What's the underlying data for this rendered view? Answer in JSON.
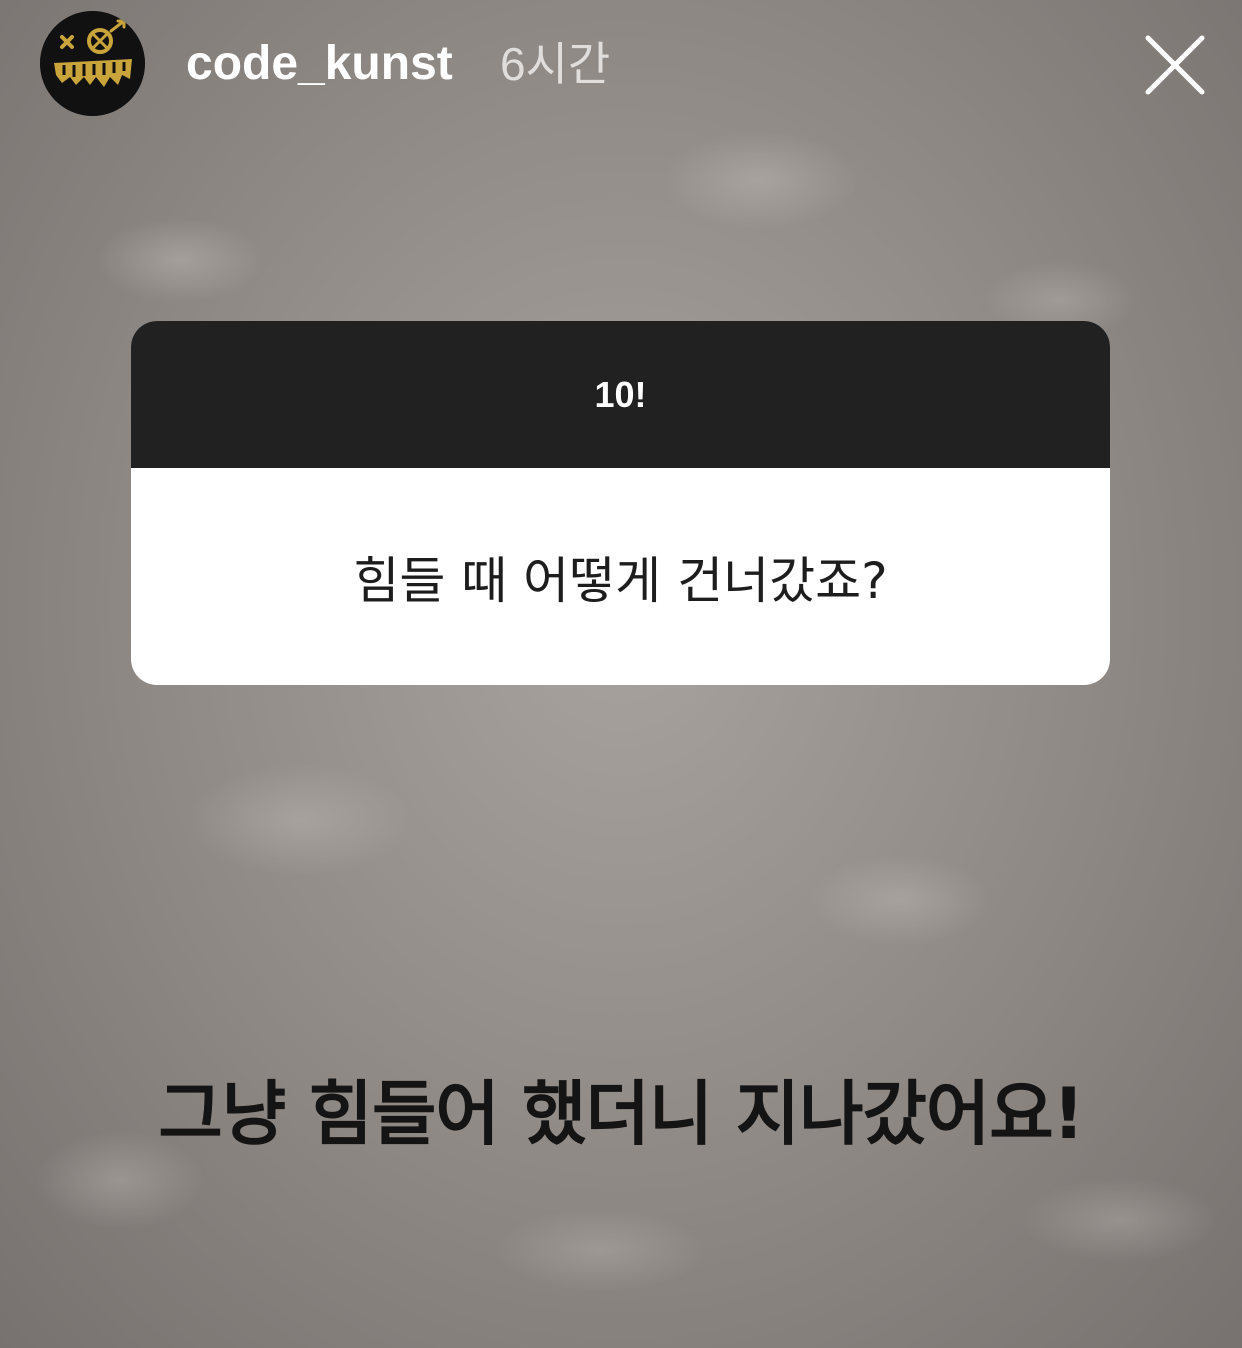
{
  "story": {
    "username": "code_kunst",
    "time_ago": "6시간",
    "avatar_icon": "code-kunst-logo-icon",
    "close_icon": "close-icon"
  },
  "question_sticker": {
    "header": "10!",
    "question": "힘들 때 어떻게 건너갔죠?"
  },
  "answer": {
    "text": "그냥 힘들어 했더니 지나갔어요!"
  },
  "colors": {
    "sticker_header_bg": "#222121",
    "sticker_body_bg": "#ffffff",
    "avatar_bg": "#111111",
    "logo_gold": "#c9a43a",
    "username_text": "#ffffff",
    "answer_text": "#141414"
  }
}
